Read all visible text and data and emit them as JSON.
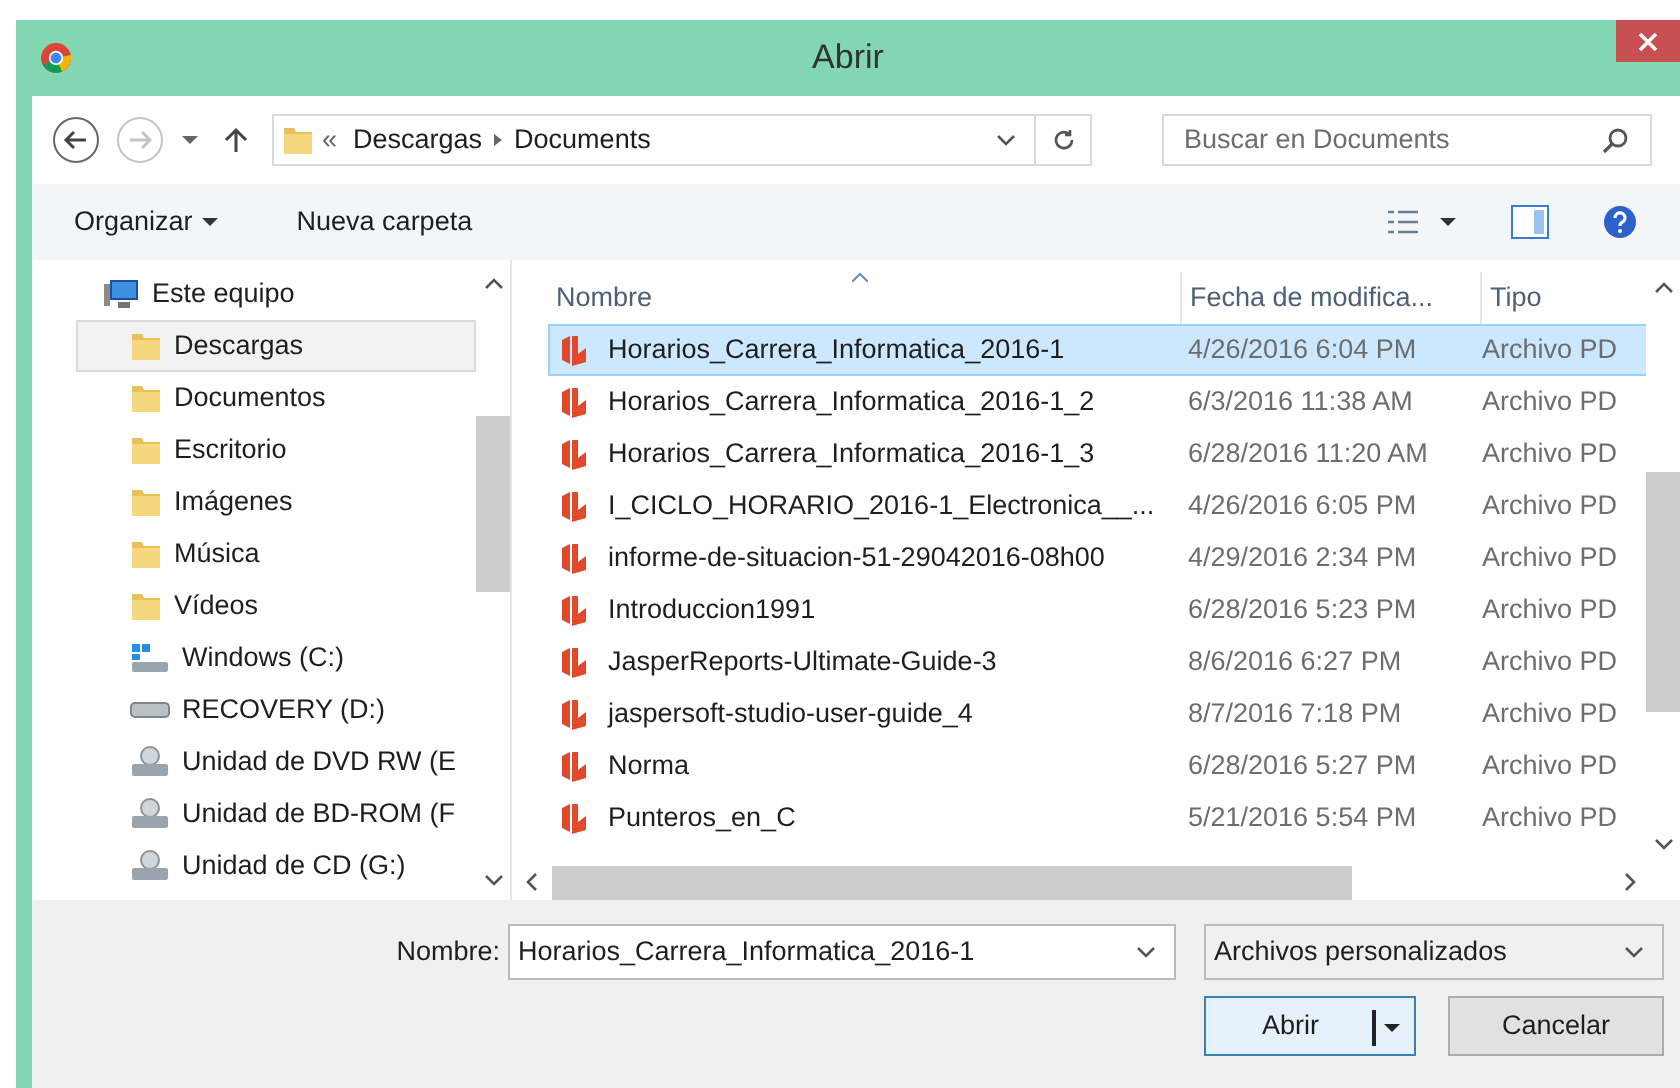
{
  "window": {
    "title": "Abrir"
  },
  "address": {
    "overflow": "«",
    "crumbs": [
      "Descargas",
      "Documents"
    ]
  },
  "search": {
    "placeholder": "Buscar en Documents"
  },
  "toolbar": {
    "organize": "Organizar",
    "new_folder": "Nueva carpeta"
  },
  "sidebar": {
    "root": {
      "label": "Este equipo",
      "kind": "computer"
    },
    "items": [
      {
        "label": "Descargas",
        "kind": "folder",
        "selected": true
      },
      {
        "label": "Documentos",
        "kind": "folder",
        "selected": false
      },
      {
        "label": "Escritorio",
        "kind": "folder",
        "selected": false
      },
      {
        "label": "Imágenes",
        "kind": "folder",
        "selected": false
      },
      {
        "label": "Música",
        "kind": "folder",
        "selected": false
      },
      {
        "label": "Vídeos",
        "kind": "folder",
        "selected": false
      },
      {
        "label": "Windows (C:)",
        "kind": "system-drive",
        "selected": false
      },
      {
        "label": "RECOVERY (D:)",
        "kind": "drive",
        "selected": false
      },
      {
        "label": "Unidad de DVD RW (E",
        "kind": "optical",
        "selected": false
      },
      {
        "label": "Unidad de BD-ROM (F",
        "kind": "optical",
        "selected": false
      },
      {
        "label": "Unidad de CD (G:)",
        "kind": "optical",
        "selected": false
      }
    ]
  },
  "table": {
    "columns": [
      "Nombre",
      "Fecha de modifica...",
      "Tipo"
    ],
    "rows": [
      {
        "name": "Horarios_Carrera_Informatica_2016-1",
        "date": "4/26/2016 6:04 PM",
        "type": "Archivo PD",
        "selected": true
      },
      {
        "name": "Horarios_Carrera_Informatica_2016-1_2",
        "date": "6/3/2016 11:38 AM",
        "type": "Archivo PD",
        "selected": false
      },
      {
        "name": "Horarios_Carrera_Informatica_2016-1_3",
        "date": "6/28/2016 11:20 AM",
        "type": "Archivo PD",
        "selected": false
      },
      {
        "name": "I_CICLO_HORARIO_2016-1_Electronica__...",
        "date": "4/26/2016 6:05 PM",
        "type": "Archivo PD",
        "selected": false
      },
      {
        "name": "informe-de-situacion-51-29042016-08h00",
        "date": "4/29/2016 2:34 PM",
        "type": "Archivo PD",
        "selected": false
      },
      {
        "name": "Introduccion1991",
        "date": "6/28/2016 5:23 PM",
        "type": "Archivo PD",
        "selected": false
      },
      {
        "name": "JasperReports-Ultimate-Guide-3",
        "date": "8/6/2016 6:27 PM",
        "type": "Archivo PD",
        "selected": false
      },
      {
        "name": "jaspersoft-studio-user-guide_4",
        "date": "8/7/2016 7:18 PM",
        "type": "Archivo PD",
        "selected": false
      },
      {
        "name": "Norma",
        "date": "6/28/2016 5:27 PM",
        "type": "Archivo PD",
        "selected": false
      },
      {
        "name": "Punteros_en_C",
        "date": "5/21/2016 5:54 PM",
        "type": "Archivo PD",
        "selected": false
      }
    ]
  },
  "footer": {
    "name_label": "Nombre:",
    "name_value": "Horarios_Carrera_Informatica_2016-1",
    "filter": "Archivos personalizados",
    "open": "Abrir",
    "cancel": "Cancelar"
  }
}
